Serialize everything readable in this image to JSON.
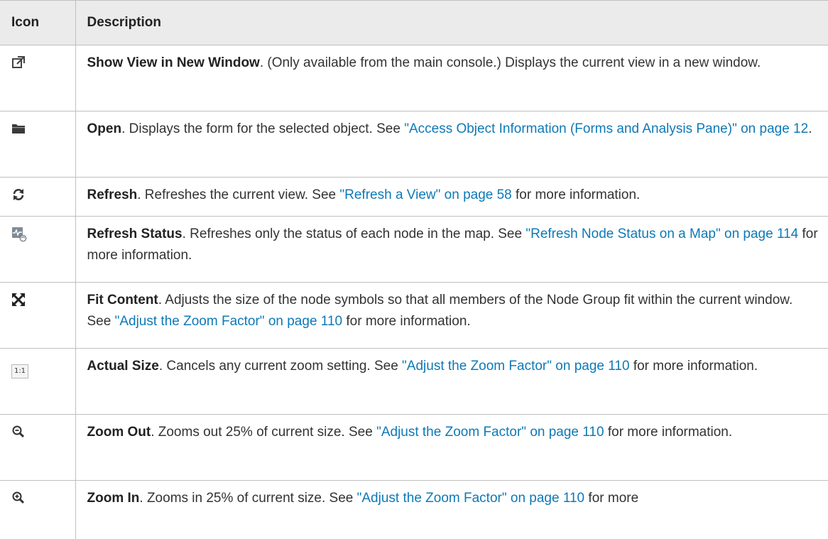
{
  "table": {
    "headers": {
      "icon": "Icon",
      "description": "Description"
    },
    "rows": [
      {
        "icon": "new-window-icon",
        "title": "Show View in New Window",
        "text": ". (Only available from the main console.) Displays the current view in a new window.",
        "link": "",
        "after": ""
      },
      {
        "icon": "folder-open-icon",
        "title": "Open",
        "text": ". Displays the form for the selected object. See ",
        "link": "\"Access Object Information (Forms and Analysis Pane)\" on page 12",
        "after": "."
      },
      {
        "icon": "refresh-icon",
        "title": "Refresh",
        "text": ". Refreshes the current view. See ",
        "link": "\"Refresh a View\" on page 58",
        "after": " for more information."
      },
      {
        "icon": "refresh-status-icon",
        "title": "Refresh Status",
        "text": ". Refreshes only the status of each node in the map. See ",
        "link": "\"Refresh Node Status on a Map\" on page 114",
        "after": " for more information."
      },
      {
        "icon": "fit-content-icon",
        "title": "Fit Content",
        "text": ". Adjusts the size of the node symbols so that all members of the Node Group fit within the current window. See ",
        "link": "\"Adjust the Zoom Factor\" on page 110",
        "after": " for more information."
      },
      {
        "icon": "actual-size-icon",
        "icon_text": "1:1",
        "title": "Actual Size",
        "text": ". Cancels any current zoom setting. See ",
        "link": "\"Adjust the Zoom Factor\" on page 110",
        "after": " for more information."
      },
      {
        "icon": "zoom-out-icon",
        "title": "Zoom Out",
        "text": ". Zooms out 25% of current size. See ",
        "link": "\"Adjust the Zoom Factor\" on page 110",
        "after": " for more information."
      },
      {
        "icon": "zoom-in-icon",
        "title": "Zoom In",
        "text": ". Zooms in 25% of current size. See ",
        "link": "\"Adjust the Zoom Factor\" on page 110",
        "after": " for more"
      }
    ]
  },
  "colors": {
    "link": "#0e79b6",
    "header_bg": "#ebebeb",
    "border": "#bfbfbf",
    "text": "#333333"
  }
}
